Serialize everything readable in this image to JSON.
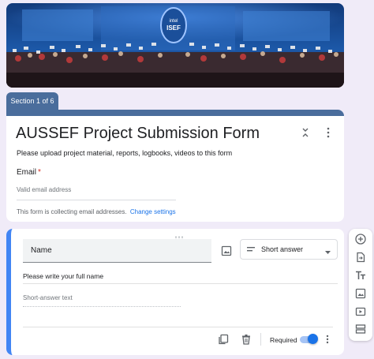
{
  "section": {
    "tab_label": "Section 1 of 6"
  },
  "form": {
    "title": "AUSSEF Project Submission Form",
    "description": "Please upload project material, reports, logbooks, videos to this form",
    "email_label": "Email",
    "required_mark": "*",
    "email_placeholder": "Valid email address",
    "collecting_note": "This form is collecting email addresses.",
    "change_settings": "Change settings"
  },
  "question": {
    "title": "Name",
    "type": "Short answer",
    "description": "Please write your full name",
    "answer_placeholder": "Short-answer text",
    "required_label": "Required",
    "required_on": true
  },
  "toolbar": {
    "items": [
      "add-question-icon",
      "import-questions-icon",
      "add-title-icon",
      "add-image-icon",
      "add-video-icon",
      "add-section-icon"
    ]
  },
  "colors": {
    "header": "#4a6d9c",
    "accent": "#4285f4",
    "background": "#f0ebf8",
    "link": "#1a73e8"
  }
}
